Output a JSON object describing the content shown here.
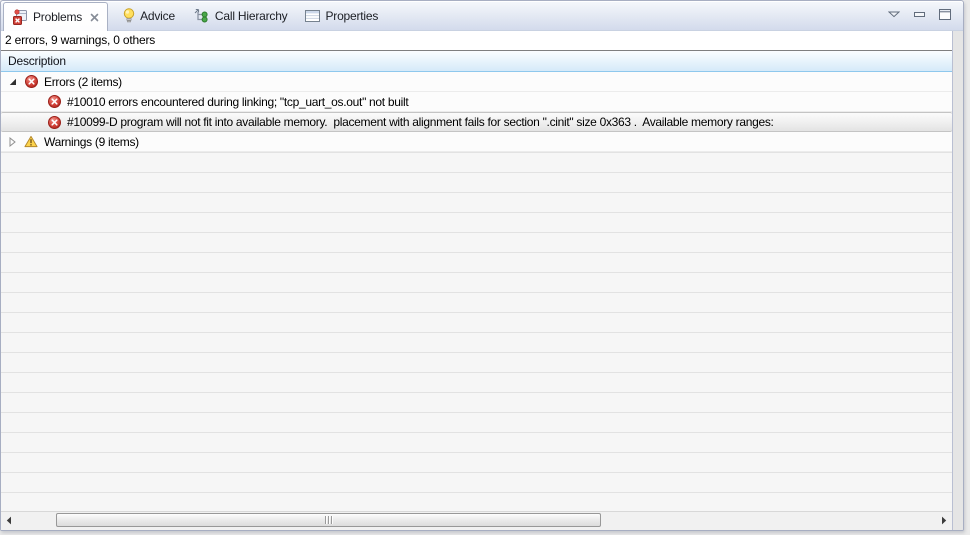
{
  "view": {
    "tabs": [
      {
        "label": "Problems",
        "active": true
      },
      {
        "label": "Advice"
      },
      {
        "label": "Call Hierarchy"
      },
      {
        "label": "Properties"
      }
    ],
    "summary": "2 errors, 9 warnings, 0 others",
    "columns": {
      "description": "Description"
    },
    "tree": {
      "errors_group": "Errors (2 items)",
      "error_1": "#10010 errors encountered during linking; \"tcp_uart_os.out\" not built",
      "error_2": "#10099-D program will not fit into available memory.  placement with alignment fails for section \".cinit\" size 0x363 .  Available memory ranges:",
      "warnings_group": "Warnings (9 items)"
    },
    "icons": {
      "problems_tab": "problems-view-icon",
      "advice_tab": "lightbulb-icon",
      "call_hierarchy_tab": "call-hierarchy-icon",
      "properties_tab": "properties-table-icon",
      "error": "error-icon",
      "warning": "warning-icon"
    },
    "colors": {
      "error_red": "#c4332a",
      "warning_yellow": "#fcd34d",
      "header_gradient_bottom": "#d5eaf9",
      "header_border_blue": "#8ec8ed",
      "tabbar_gradient_bottom": "#d3dbec",
      "selection_border": "#c4c4c4",
      "panel_border": "#a7aec2"
    }
  }
}
